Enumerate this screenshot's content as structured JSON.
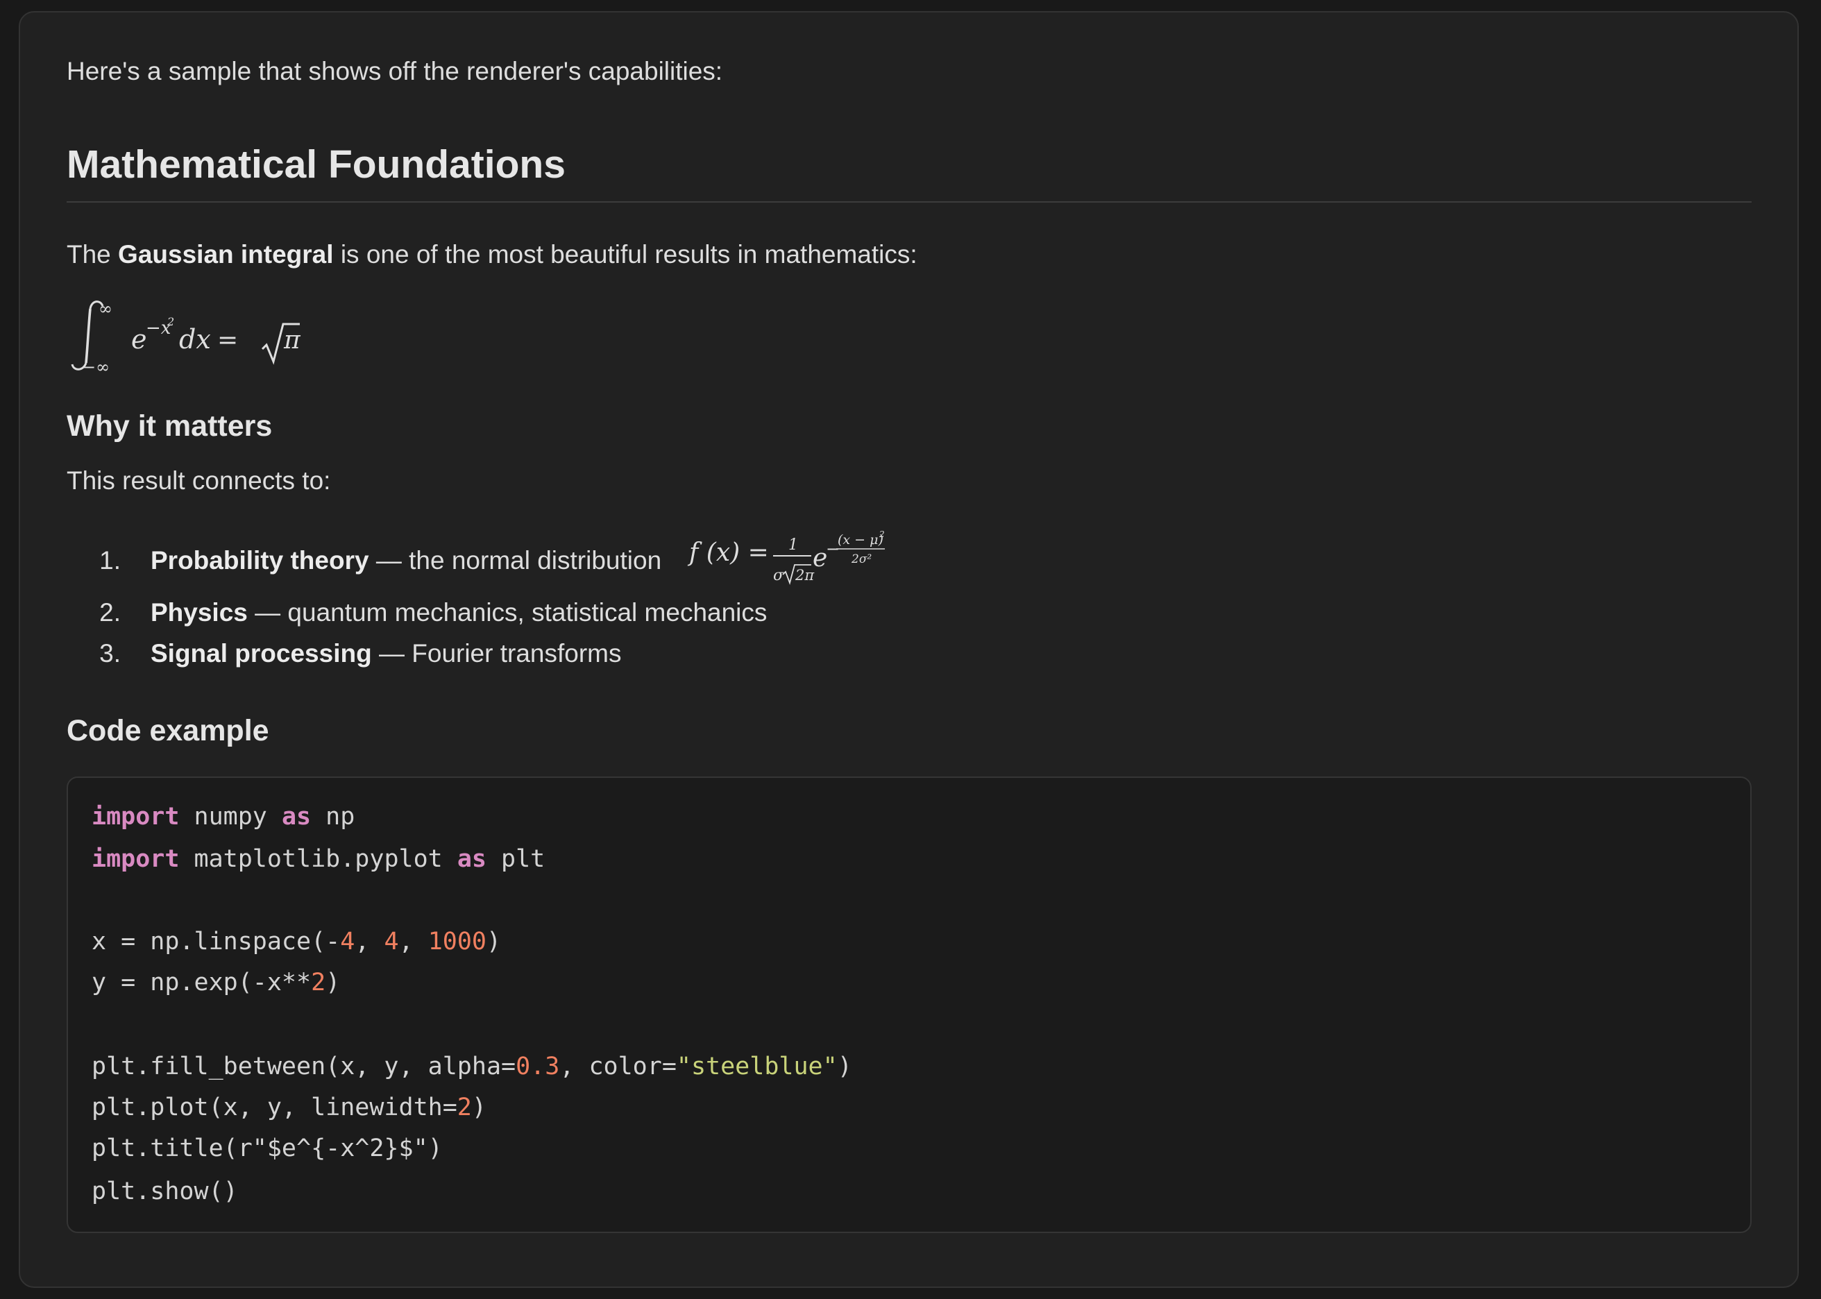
{
  "intro": "Here's a sample that shows off the renderer's capabilities:",
  "heading1": "Mathematical Foundations",
  "paragraph1": {
    "pre": "The ",
    "bold": "Gaussian integral",
    "post": " is one of the most beautiful results in mathematics:"
  },
  "display_equation": {
    "upper_limit": "∞",
    "lower_limit": "−∞",
    "base": "e",
    "exponent": "−x",
    "exponent_power": "2",
    "differential": "dx",
    "equals": "=",
    "radicand": "π"
  },
  "heading_why": "Why it matters",
  "paragraph2": "This result connects to:",
  "list": [
    {
      "num": "1.",
      "bold": "Probability theory",
      "text": " — the normal distribution ",
      "formula": {
        "lhs": "f (x) =",
        "numerator": "1",
        "denominator_sigma": "σ",
        "denominator_radicand": "2π",
        "base": "e",
        "exp_sign": "−",
        "exp_numerator": "(x − μ)",
        "exp_numerator_power": "2",
        "exp_denominator": "2σ²"
      }
    },
    {
      "num": "2.",
      "bold": "Physics",
      "text": " — quantum mechanics, statistical mechanics"
    },
    {
      "num": "3.",
      "bold": "Signal processing",
      "text": " — Fourier transforms"
    }
  ],
  "heading_code": "Code example",
  "code": {
    "lines": [
      [
        [
          "kw",
          "import"
        ],
        [
          "txt",
          " numpy "
        ],
        [
          "kw",
          "as"
        ],
        [
          "txt",
          " np"
        ]
      ],
      [
        [
          "kw",
          "import"
        ],
        [
          "txt",
          " matplotlib.pyplot "
        ],
        [
          "kw",
          "as"
        ],
        [
          "txt",
          " plt"
        ]
      ],
      [],
      [
        [
          "txt",
          "x = np.linspace(-"
        ],
        [
          "num",
          "4"
        ],
        [
          "txt",
          ", "
        ],
        [
          "num",
          "4"
        ],
        [
          "txt",
          ", "
        ],
        [
          "num",
          "1000"
        ],
        [
          "txt",
          ")"
        ]
      ],
      [
        [
          "txt",
          "y = np.exp(-x**"
        ],
        [
          "num",
          "2"
        ],
        [
          "txt",
          ")"
        ]
      ],
      [],
      [
        [
          "txt",
          "plt.fill_between(x, y, alpha="
        ],
        [
          "num",
          "0.3"
        ],
        [
          "txt",
          ", color="
        ],
        [
          "str",
          "\"steelblue\""
        ],
        [
          "txt",
          ")"
        ]
      ],
      [
        [
          "txt",
          "plt.plot(x, y, linewidth="
        ],
        [
          "num",
          "2"
        ],
        [
          "txt",
          ")"
        ]
      ],
      [
        [
          "txt",
          "plt.title(r\"$e^{-x^2}$\")"
        ]
      ],
      [
        [
          "txt",
          "plt.show()"
        ]
      ]
    ]
  },
  "colors": {
    "background": "#191919",
    "card": "#212121",
    "code_background": "#1b1b1b",
    "keyword": "#d98ac2",
    "number": "#f08060",
    "string": "#c9d37a"
  }
}
